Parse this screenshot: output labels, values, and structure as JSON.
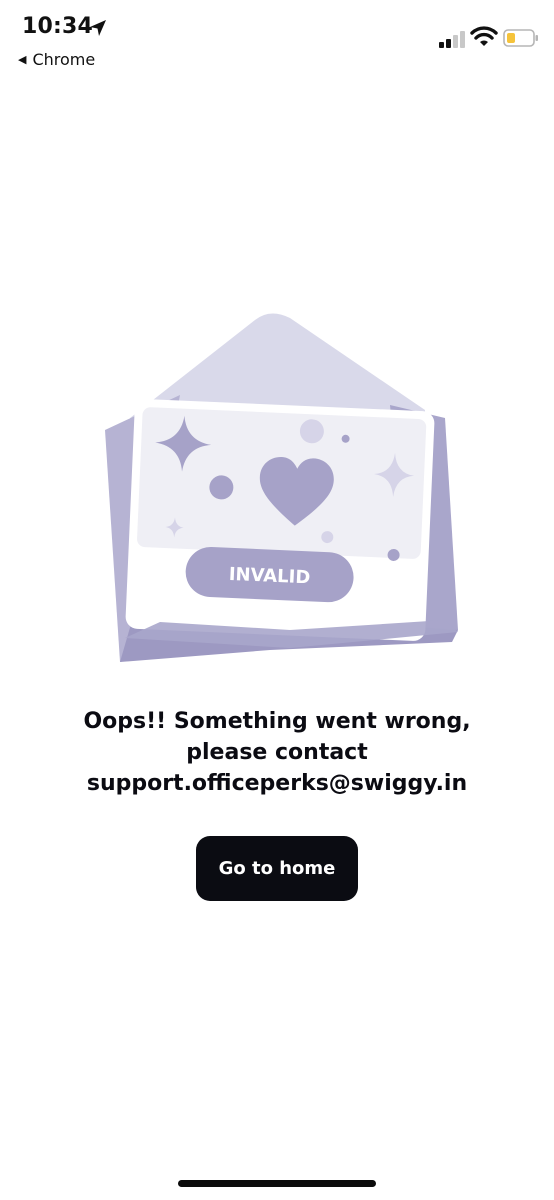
{
  "status_bar": {
    "time": "10:34",
    "back_app": "Chrome",
    "icons": [
      "location-arrow-icon",
      "cellular-signal-icon",
      "wifi-icon",
      "battery-low-icon"
    ],
    "battery_color": "#f5c33b"
  },
  "illustration": {
    "badge_text": "INVALID",
    "colors": {
      "envelope_light": "#d9d9ea",
      "envelope_dark": "#a9a6cb",
      "card_bg": "#efeff5",
      "accent": "#a6a2c8"
    }
  },
  "message": {
    "line1": "Oops!! Something went wrong,",
    "line2": "please contact",
    "line3": "support.officeperks@swiggy.in"
  },
  "actions": {
    "home_button_label": "Go to home"
  }
}
